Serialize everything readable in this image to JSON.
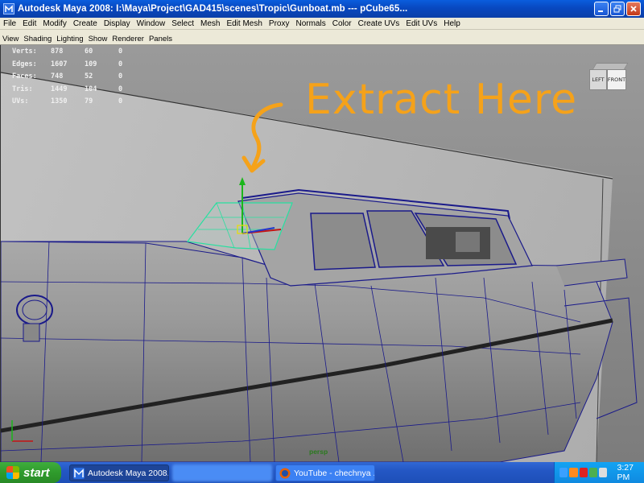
{
  "window": {
    "title": "Autodesk Maya 2008: I:\\Maya\\Project\\GAD415\\scenes\\Tropic\\Gunboat.mb   ---   pCube65..."
  },
  "menubar": [
    "File",
    "Edit",
    "Modify",
    "Create",
    "Display",
    "Window",
    "Select",
    "Mesh",
    "Edit Mesh",
    "Proxy",
    "Normals",
    "Color",
    "Create UVs",
    "Edit UVs",
    "Help"
  ],
  "panel_menu": [
    "View",
    "Shading",
    "Lighting",
    "Show",
    "Renderer",
    "Panels"
  ],
  "hud": {
    "rows": [
      {
        "label": "Verts:",
        "v1": "878",
        "v2": "60",
        "v3": "0"
      },
      {
        "label": "Edges:",
        "v1": "1607",
        "v2": "109",
        "v3": "0"
      },
      {
        "label": "Faces:",
        "v1": "748",
        "v2": "52",
        "v3": "0"
      },
      {
        "label": "Tris:",
        "v1": "1449",
        "v2": "104",
        "v3": "0"
      },
      {
        "label": "UVs:",
        "v1": "1350",
        "v2": "79",
        "v3": "0"
      }
    ]
  },
  "annotation": "Extract Here",
  "viewcube": {
    "left": "LEFT",
    "front": "FRONT"
  },
  "camera_label": "persp",
  "colors": {
    "annotation": "#f5a21a",
    "wireframe": "#1a1a8a",
    "selection": "#27e0a0",
    "viewport_bg": "#8f8f8f"
  },
  "taskbar": {
    "start": "start",
    "tasks": [
      {
        "label": "Autodesk Maya 2008...",
        "icon": "maya-icon"
      },
      {
        "label": "",
        "icon": "blurred"
      },
      {
        "label": "YouTube - chechnya ...",
        "icon": "firefox-icon"
      }
    ],
    "clock": "3:27 PM"
  }
}
